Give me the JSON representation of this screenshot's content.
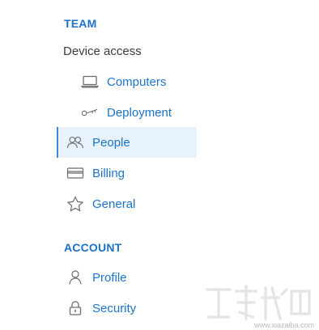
{
  "sections": {
    "team": {
      "title": "TEAM",
      "group_label": "Device access",
      "sub_items": [
        {
          "label": "Computers",
          "icon": "laptop-icon"
        },
        {
          "label": "Deployment",
          "icon": "key-icon"
        }
      ],
      "items": [
        {
          "label": "People",
          "icon": "people-icon",
          "active": true
        },
        {
          "label": "Billing",
          "icon": "credit-card-icon",
          "active": false
        },
        {
          "label": "General",
          "icon": "star-icon",
          "active": false
        }
      ]
    },
    "account": {
      "title": "ACCOUNT",
      "items": [
        {
          "label": "Profile",
          "icon": "user-icon"
        },
        {
          "label": "Security",
          "icon": "lock-icon"
        }
      ]
    }
  },
  "colors": {
    "accent": "#1b74c6",
    "active_bg": "#e8f2fc",
    "active_border": "#3f8ad8",
    "icon": "#6b6b6b"
  },
  "watermark": {
    "site": "www.xiazaiba.com"
  }
}
